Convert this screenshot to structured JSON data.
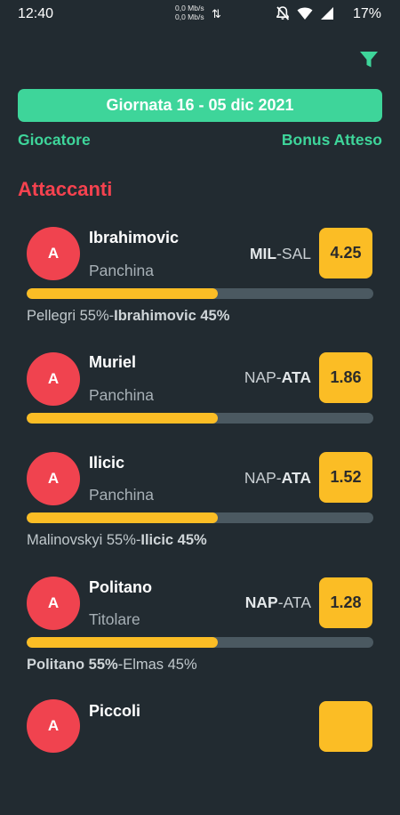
{
  "status_bar": {
    "time": "12:40",
    "net_up": "0,0 Mb/s",
    "net_down": "0,0 Mb/s",
    "battery": "17%",
    "icons": [
      "network-arrows-icon",
      "mute-icon",
      "wifi-icon",
      "signal-icon",
      "battery-icon"
    ]
  },
  "toolbar": {
    "filter_icon": "filter-icon"
  },
  "giornata_label": "Giornata 16 - 05 dic 2021",
  "columns": {
    "player": "Giocatore",
    "bonus": "Bonus Atteso"
  },
  "section_title": "Attaccanti",
  "players": [
    {
      "initial": "A",
      "name": "Ibrahimovic",
      "status": "Panchina",
      "home": "MIL",
      "sep": "-",
      "away": "SAL",
      "bold_side": "home",
      "bonus": "4.25",
      "share": 0.55,
      "pct_a": "Pellegri 55%",
      "pct_sep": "-",
      "pct_b": "Ibrahimovic 45%",
      "bold_pct": "b"
    },
    {
      "initial": "A",
      "name": "Muriel",
      "status": "Panchina",
      "home": "NAP",
      "sep": "-",
      "away": "ATA",
      "bold_side": "away",
      "bonus": "1.86",
      "share": 0.55
    },
    {
      "initial": "A",
      "name": "Ilicic",
      "status": "Panchina",
      "home": "NAP",
      "sep": "-",
      "away": "ATA",
      "bold_side": "away",
      "bonus": "1.52",
      "share": 0.55,
      "pct_a": "Malinovskyi 55%",
      "pct_sep": "-",
      "pct_b": "Ilicic 45%",
      "bold_pct": "b"
    },
    {
      "initial": "A",
      "name": "Politano",
      "status": "Titolare",
      "home": "NAP",
      "sep": "-",
      "away": "ATA",
      "bold_side": "home",
      "bonus": "1.28",
      "share": 0.55,
      "pct_a": "Politano 55%",
      "pct_sep": "-",
      "pct_b": "Elmas 45%",
      "bold_pct": "a"
    },
    {
      "initial": "A",
      "name": "Piccoli",
      "status": "",
      "bonus": ""
    }
  ],
  "colors": {
    "background": "#222b31",
    "accent_green": "#3ed59a",
    "section_red": "#f5424f",
    "avatar_red": "#f0434f",
    "bonus_yellow": "#fbbd25",
    "bar_track": "#4b5961"
  }
}
